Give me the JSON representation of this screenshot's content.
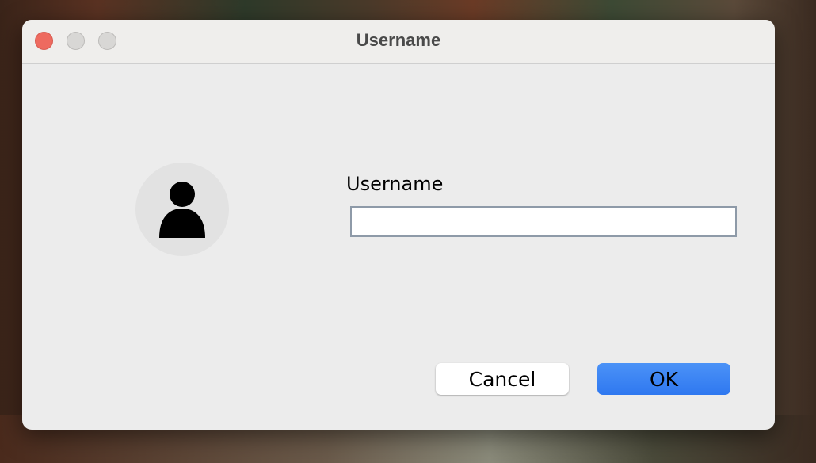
{
  "window": {
    "title": "Username"
  },
  "form": {
    "label": "Username",
    "value": "",
    "placeholder": ""
  },
  "buttons": {
    "cancel": "Cancel",
    "ok": "OK"
  },
  "icons": {
    "avatar": "person-icon"
  },
  "colors": {
    "accent": "#3a82f6",
    "close": "#ee6a5f"
  }
}
